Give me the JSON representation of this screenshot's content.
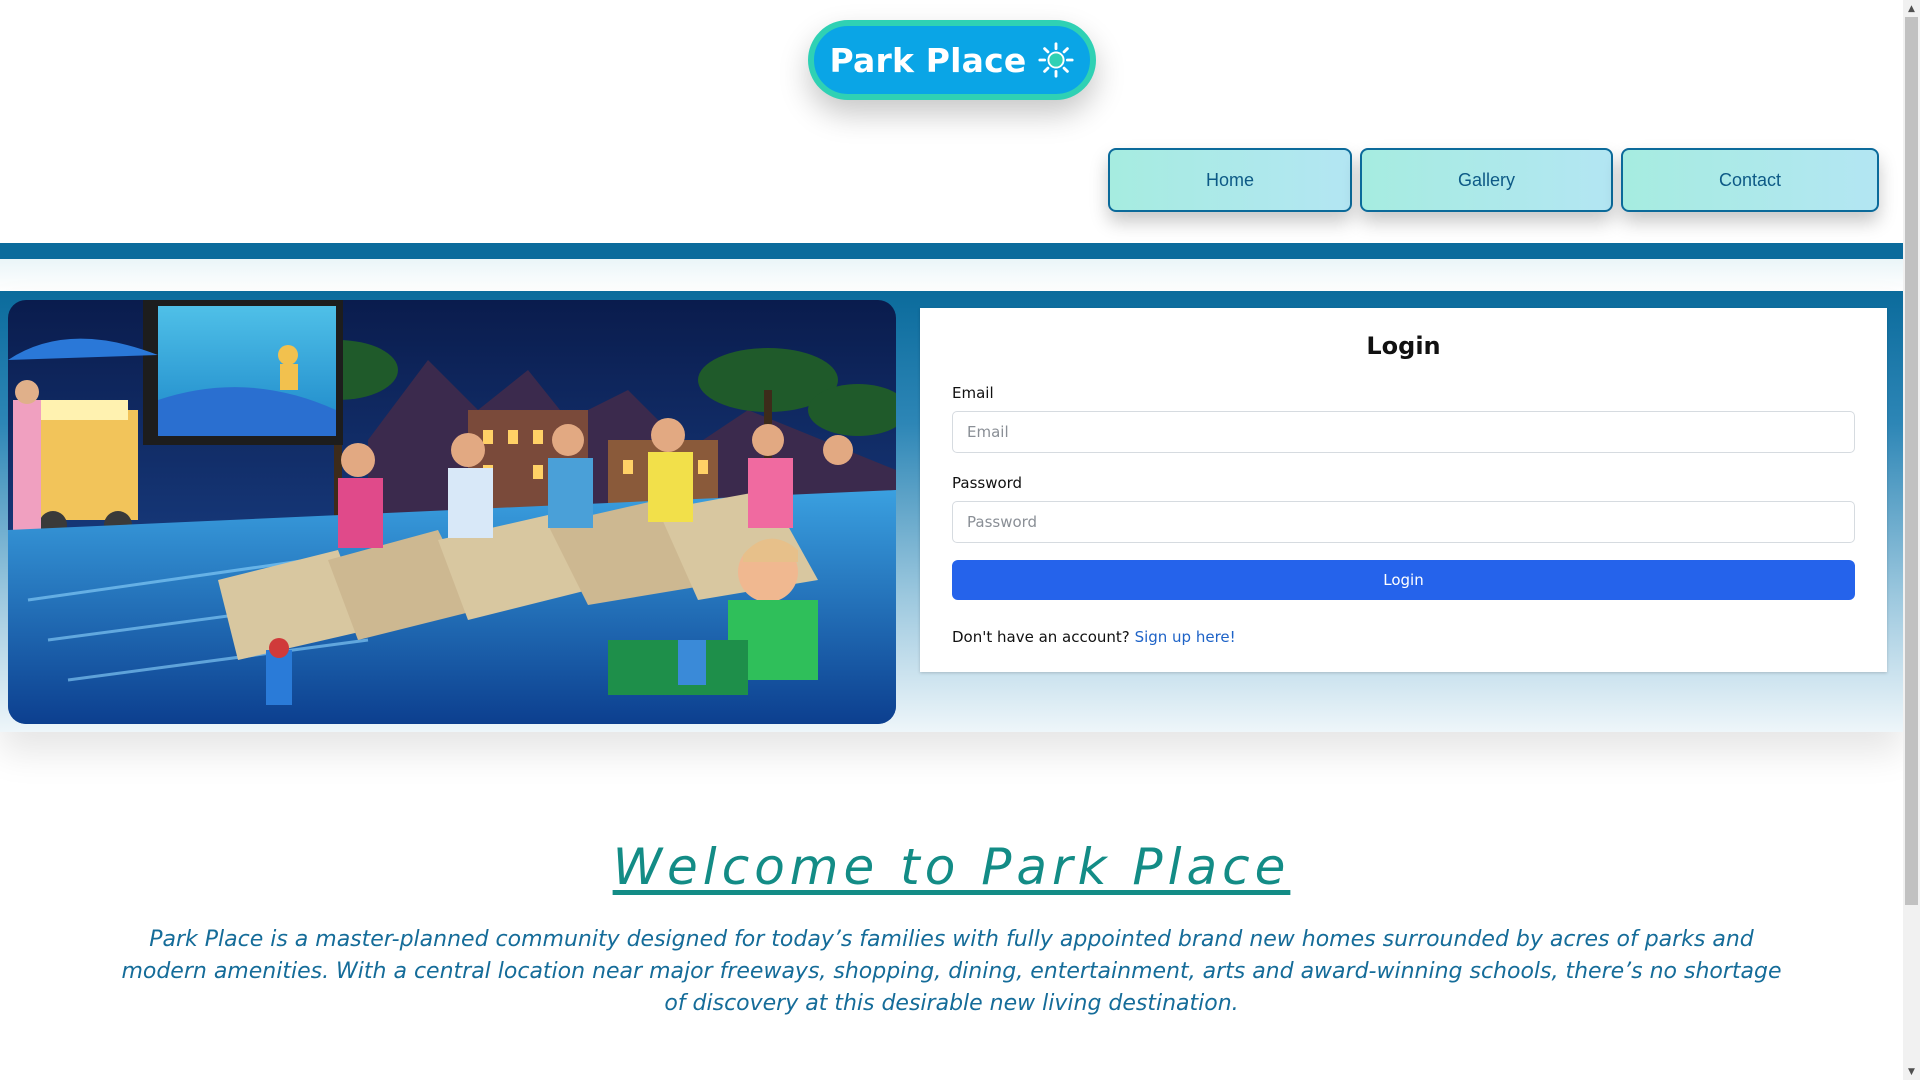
{
  "logo": {
    "text": "Park Place",
    "icon": "sun-icon"
  },
  "nav": {
    "items": [
      {
        "label": "Home"
      },
      {
        "label": "Gallery"
      },
      {
        "label": "Contact"
      }
    ]
  },
  "hero": {
    "image": "outdoor-pool-movie-night-photo"
  },
  "login": {
    "title": "Login",
    "email_label": "Email",
    "email_placeholder": "Email",
    "email_value": "",
    "password_label": "Password",
    "password_placeholder": "Password",
    "password_value": "",
    "submit_label": "Login",
    "signup_prompt": "Don't have an account?",
    "signup_link": "Sign up here!"
  },
  "welcome": {
    "title": "Welcome to Park Place",
    "text": "Park Place is a master-planned community designed for today’s families with fully appointed brand new homes surrounded by acres of parks and modern amenities. With a central location near major freeways, shopping, dining, entertainment, arts and award-winning schools, there’s no shortage of discovery at this desirable new living destination."
  },
  "colors": {
    "brand": "#0aa5e6",
    "brand_border": "#2fd1b4",
    "stripe": "#0b6b9c",
    "button": "#2563eb",
    "heading": "#138c86",
    "body_text": "#156c99"
  }
}
